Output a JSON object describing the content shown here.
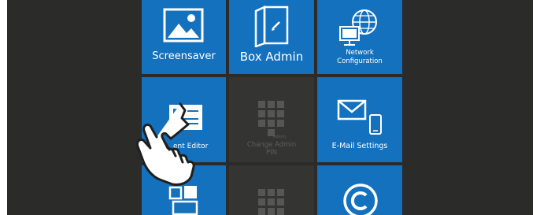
{
  "tiles": {
    "screensaver": {
      "label": "Screensaver",
      "icon": "image-icon"
    },
    "box_admin": {
      "label": "Box Admin",
      "icon": "book-edit-icon"
    },
    "network_configuration": {
      "label_line1": "Network",
      "label_line2": "Configuration",
      "icon": "globe-computer-icon"
    },
    "content_editor": {
      "label": "ent Editor",
      "icon": "document-icon"
    },
    "change_admin_pin": {
      "label_line1": "Change Admin",
      "label_line2": "PIN",
      "badge": "Admin",
      "icon": "keypad-icon"
    },
    "email_settings": {
      "label": "E-Mail Settings",
      "icon": "mail-phone-icon"
    },
    "copy_tile": {
      "icon": "windows-icon"
    },
    "keypad_tile": {
      "icon": "keypad-icon"
    },
    "copyright_tile": {
      "icon": "copyright-icon"
    }
  },
  "cursor": {
    "icon": "hand-pointer-icon"
  },
  "colors": {
    "tile_blue": "#1471be",
    "tile_disabled": "#343433",
    "background": "#2b2b29"
  }
}
